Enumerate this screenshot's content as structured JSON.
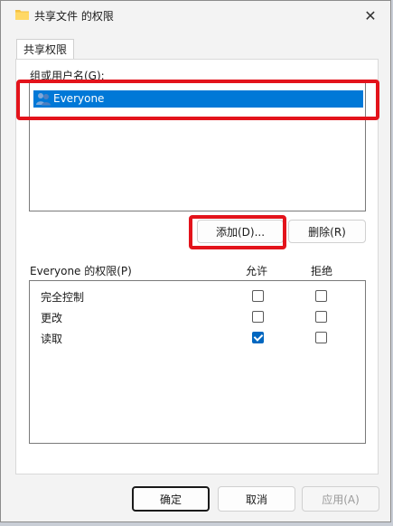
{
  "window": {
    "title": "共享文件 的权限",
    "close_label": "✕"
  },
  "tabs": [
    {
      "label": "共享权限"
    }
  ],
  "groups": {
    "label": "组或用户名(G):",
    "items": [
      {
        "name": "Everyone",
        "selected": true
      }
    ]
  },
  "buttons": {
    "add": "添加(D)...",
    "remove": "删除(R)",
    "ok": "确定",
    "cancel": "取消",
    "apply": "应用(A)"
  },
  "permissions": {
    "header": "Everyone 的权限(P)",
    "allow_col": "允许",
    "deny_col": "拒绝",
    "rows": [
      {
        "name": "完全控制",
        "allow": false,
        "deny": false
      },
      {
        "name": "更改",
        "allow": false,
        "deny": false
      },
      {
        "name": "读取",
        "allow": true,
        "deny": false
      }
    ]
  },
  "colors": {
    "selection": "#0078d7",
    "highlight_box": "#e3131b",
    "checkbox_checked": "#0067c0"
  }
}
